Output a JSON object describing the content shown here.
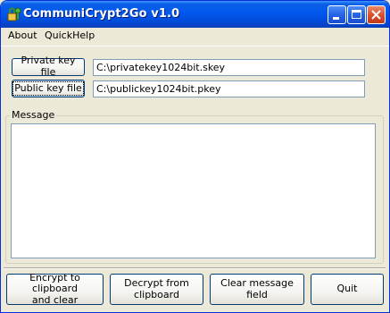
{
  "window": {
    "title": "CommuniCrypt2Go v1.0",
    "icon": "key-lock-icon",
    "controls": [
      "minimize-icon",
      "maximize-icon",
      "close-icon"
    ]
  },
  "menu": {
    "items": [
      {
        "label": "About"
      },
      {
        "label": "QuickHelp"
      }
    ]
  },
  "keys": {
    "private_button": "Private key file",
    "private_path": "C:\\privatekey1024bit.skey",
    "public_button": "Public key file",
    "public_path": "C:\\publickey1024bit.pkey"
  },
  "message": {
    "group_label": "Message",
    "value": ""
  },
  "actions": {
    "encrypt_line1": "Encrypt to clipboard",
    "encrypt_line2": "and clear",
    "decrypt_line1": "Decrypt from",
    "decrypt_line2": "clipboard",
    "clear": "Clear message field",
    "quit": "Quit"
  },
  "colors": {
    "titlebar": "#0058ee",
    "close_button": "#d94e2c",
    "window_bg": "#ece9d8"
  }
}
